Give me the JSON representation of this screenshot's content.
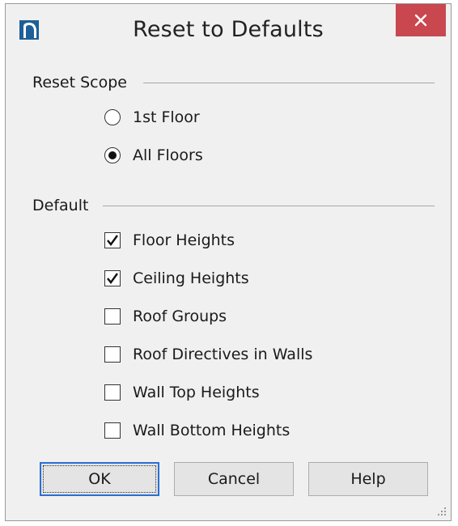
{
  "dialog": {
    "title": "Reset to Defaults",
    "close_label": "✕"
  },
  "reset_scope": {
    "label": "Reset Scope",
    "options": [
      {
        "label": "1st Floor",
        "selected": false
      },
      {
        "label": "All Floors",
        "selected": true
      }
    ]
  },
  "default": {
    "label": "Default",
    "items": [
      {
        "label": "Floor Heights",
        "checked": true
      },
      {
        "label": "Ceiling Heights",
        "checked": true
      },
      {
        "label": "Roof Groups",
        "checked": false
      },
      {
        "label": "Roof Directives in Walls",
        "checked": false
      },
      {
        "label": "Wall Top Heights",
        "checked": false
      },
      {
        "label": "Wall Bottom Heights",
        "checked": false
      }
    ]
  },
  "buttons": {
    "ok": "OK",
    "cancel": "Cancel",
    "help": "Help"
  },
  "colors": {
    "close_button": "#c9474f",
    "app_icon": "#1f5f97",
    "default_button_border": "#2a6fd6"
  }
}
